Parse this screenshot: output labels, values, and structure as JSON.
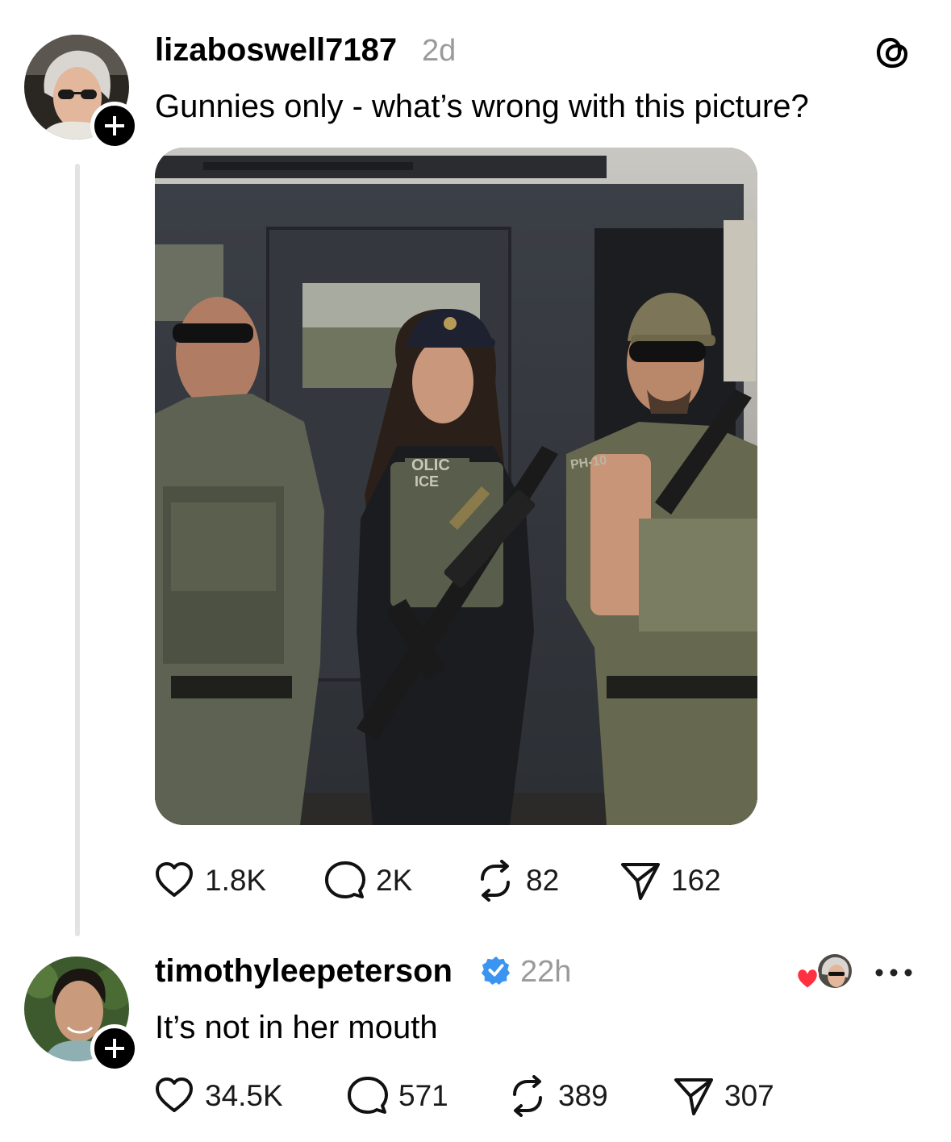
{
  "post": {
    "username": "lizaboswell7187",
    "time": "2d",
    "text": "Gunnies only - what’s wrong with this picture?",
    "image_patches": [
      "OLIC",
      "ICE",
      "PH-10"
    ],
    "actions": {
      "likes": "1.8K",
      "replies": "2K",
      "reposts": "82",
      "shares": "162"
    }
  },
  "reply": {
    "username": "timothyleepeterson",
    "verified": true,
    "time": "22h",
    "text": "It’s not in her mouth",
    "actions": {
      "likes": "34.5K",
      "replies": "571",
      "reposts": "389",
      "shares": "307"
    }
  },
  "colors": {
    "verified": "#3b95f0",
    "heart_liked": "#ff3040",
    "secondary_text": "#9a9a9a",
    "thread_line": "#e3e3e3"
  },
  "icons": {
    "app_logo": "threads-logo-icon",
    "like": "heart-icon",
    "reply": "comment-bubble-icon",
    "repost": "repost-icon",
    "share": "paper-plane-icon",
    "follow": "plus-icon",
    "more": "more-dots-icon"
  }
}
